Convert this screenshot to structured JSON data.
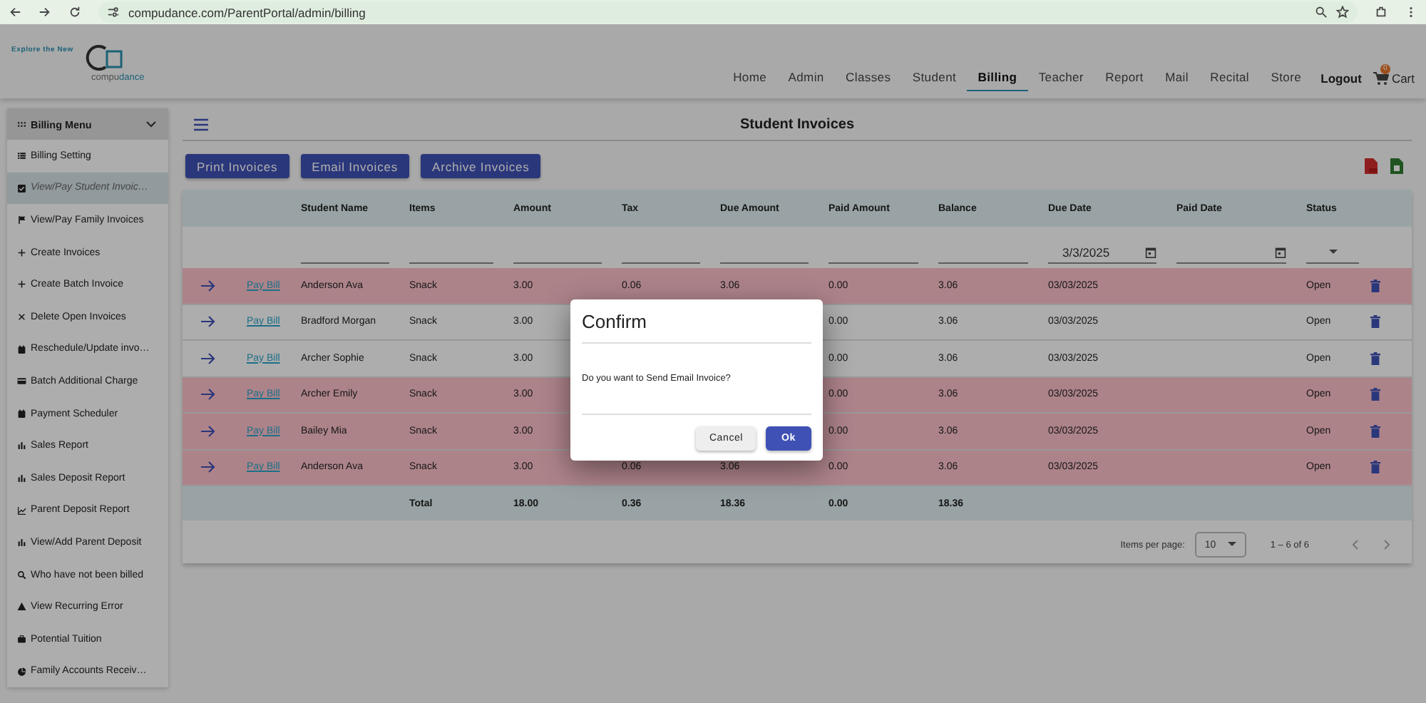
{
  "browser": {
    "url": "compudance.com/ParentPortal/admin/billing"
  },
  "header": {
    "logo_tagline": "Explore the New",
    "logo_brand_a": "compu",
    "logo_brand_b": "dance",
    "nav": [
      {
        "label": "Home",
        "selected": false
      },
      {
        "label": "Admin",
        "selected": false
      },
      {
        "label": "Classes",
        "selected": false
      },
      {
        "label": "Student",
        "selected": false
      },
      {
        "label": "Billing",
        "selected": true
      },
      {
        "label": "Teacher",
        "selected": false
      },
      {
        "label": "Report",
        "selected": false
      },
      {
        "label": "Mail",
        "selected": false
      },
      {
        "label": "Recital",
        "selected": false
      },
      {
        "label": "Store",
        "selected": false
      }
    ],
    "logout": "Logout",
    "cart": "Cart",
    "cart_count": "0"
  },
  "sidebar": {
    "title": "Billing Menu",
    "expanded": true,
    "items": [
      {
        "label": "Billing Setting",
        "selected": false
      },
      {
        "label": "View/Pay Student Invoic…",
        "selected": true
      },
      {
        "label": "View/Pay Family Invoices",
        "selected": false
      },
      {
        "label": "Create Invoices",
        "selected": false
      },
      {
        "label": "Create Batch Invoice",
        "selected": false
      },
      {
        "label": "Delete Open Invoices",
        "selected": false
      },
      {
        "label": "Reschedule/Update invo…",
        "selected": false
      },
      {
        "label": "Batch Additional Charge",
        "selected": false
      },
      {
        "label": "Payment Scheduler",
        "selected": false
      },
      {
        "label": "Sales Report",
        "selected": false
      },
      {
        "label": "Sales Deposit Report",
        "selected": false
      },
      {
        "label": "Parent Deposit Report",
        "selected": false
      },
      {
        "label": "View/Add Parent Deposit",
        "selected": false
      },
      {
        "label": "Who have not been billed",
        "selected": false
      },
      {
        "label": "View Recurring Error",
        "selected": false
      },
      {
        "label": "Potential Tuition",
        "selected": false
      },
      {
        "label": "Family Accounts Receiv…",
        "selected": false
      }
    ]
  },
  "page_title": "Student Invoices",
  "actions": [
    "Print Invoices",
    "Email Invoices",
    "Archive Invoices"
  ],
  "table": {
    "columns": [
      "Student Name",
      "Items",
      "Amount",
      "Tax",
      "Due Amount",
      "Paid Amount",
      "Balance",
      "Due Date",
      "Paid Date",
      "Status"
    ],
    "due_date_filter": "3/3/2025",
    "rows": [
      {
        "link": "Pay Bill",
        "student": "Anderson Ava",
        "item": "Snack",
        "amount": "3.00",
        "tax": "0.06",
        "due_amount": "3.06",
        "paid_amount": "0.00",
        "balance": "3.06",
        "due_date": "03/03/2025",
        "status": "Open",
        "highlighted": true
      },
      {
        "link": "Pay Bill",
        "student": "Bradford Morgan",
        "item": "Snack",
        "amount": "3.00",
        "paid_amount": "0.00",
        "balance": "3.06",
        "due_date": "03/03/2025",
        "status": "Open",
        "highlighted": false
      },
      {
        "link": "Pay Bill",
        "student": "Archer Sophie",
        "item": "Snack",
        "amount": "3.00",
        "paid_amount": "0.00",
        "balance": "3.06",
        "due_date": "03/03/2025",
        "status": "Open",
        "highlighted": false
      },
      {
        "link": "Pay Bill",
        "student": "Archer Emily",
        "item": "Snack",
        "amount": "3.00",
        "paid_amount": "0.00",
        "balance": "3.06",
        "due_date": "03/03/2025",
        "status": "Open",
        "highlighted": true
      },
      {
        "link": "Pay Bill",
        "student": "Bailey Mia",
        "item": "Snack",
        "amount": "3.00",
        "paid_amount": "0.00",
        "balance": "3.06",
        "due_date": "03/03/2025",
        "status": "Open",
        "highlighted": true
      },
      {
        "link": "Pay Bill",
        "student": "Anderson Ava",
        "item": "Snack",
        "amount": "3.00",
        "tax": "0.06",
        "due_amount": "3.06",
        "paid_amount": "0.00",
        "balance": "3.06",
        "due_date": "03/03/2025",
        "status": "Open",
        "highlighted": true
      }
    ],
    "total": {
      "label": "Total",
      "amount": "18.00",
      "tax": "0.36",
      "due_amount": "18.36",
      "paid_amount": "0.00",
      "balance": "18.36"
    }
  },
  "paginator": {
    "label": "Items per page:",
    "page_size": "10",
    "range": "1 – 6 of 6"
  },
  "dialog": {
    "title": "Confirm",
    "message": "Do you want to Send Email Invoice?",
    "buttons": [
      "Cancel",
      "Ok"
    ]
  }
}
